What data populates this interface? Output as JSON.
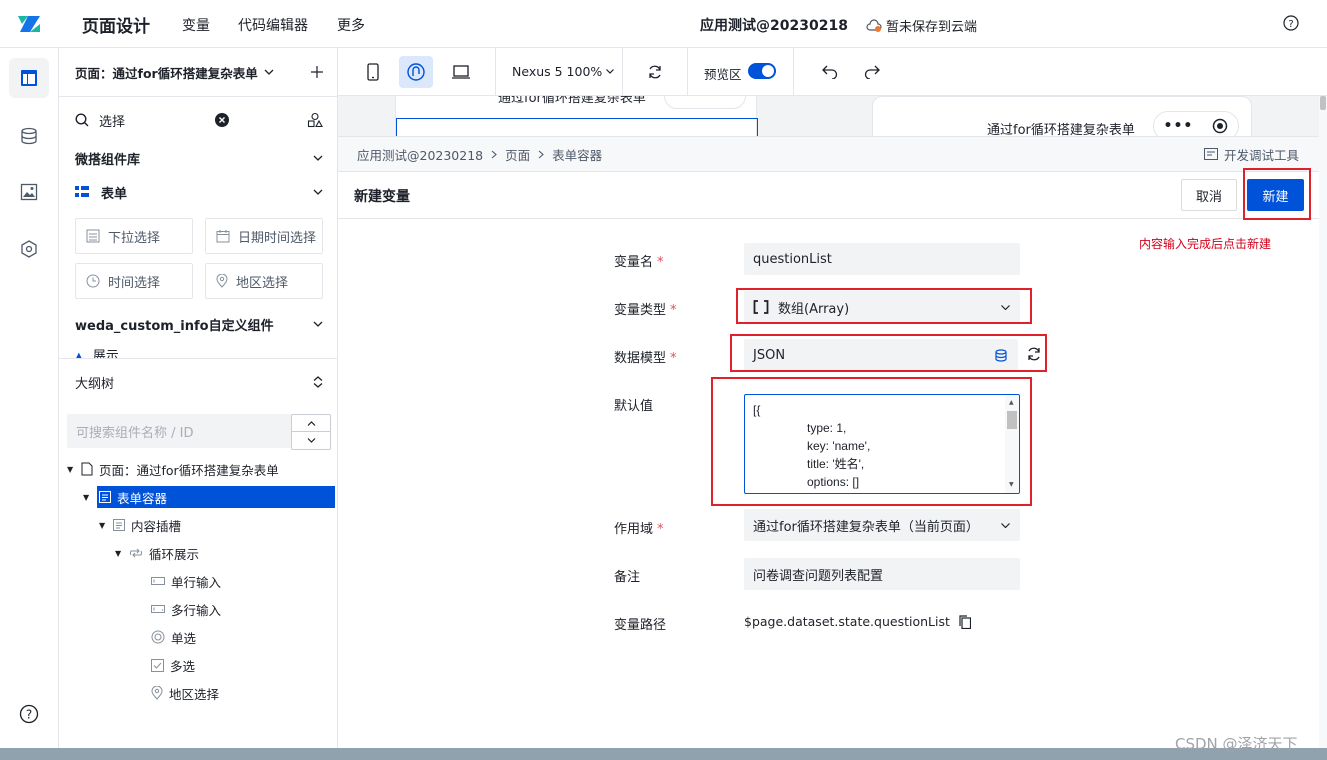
{
  "topbar": {
    "title": "页面设计",
    "nav": [
      "变量",
      "代码编辑器",
      "更多"
    ],
    "app_name": "应用测试@20230218",
    "save_status": "暂未保存到云端"
  },
  "left_panel": {
    "page_selector": "页面：通过for循环搭建复杂表单",
    "search_value": "选择",
    "library_title": "微搭组件库",
    "category": "表单",
    "components": [
      "下拉选择",
      "日期时间选择",
      "时间选择",
      "地区选择"
    ],
    "custom_group": "weda_custom_info自定义组件",
    "custom_partial": "展示",
    "outline_title": "大纲树",
    "outline_search_placeholder": "可搜索组件名称 / ID",
    "tree": {
      "page": "页面：通过for循环搭建复杂表单",
      "form_container": "表单容器",
      "content_slot": "内容插槽",
      "loop": "循环展示",
      "items": [
        "单行输入",
        "多行输入",
        "单选",
        "多选",
        "地区选择"
      ]
    }
  },
  "toolbar": {
    "device": "Nexus 5 100%",
    "preview_label": "预览区"
  },
  "canvas": {
    "left_title": "通过for循环搭建复杂表单",
    "right_title": "通过for循环搭建复杂表单"
  },
  "dialog": {
    "breadcrumb": [
      "应用测试@20230218",
      "页面",
      "表单容器"
    ],
    "dev_tools": "开发调试工具",
    "title": "新建变量",
    "cancel": "取消",
    "create": "新建",
    "annotation": "内容输入完成后点击新建",
    "labels": {
      "name": "变量名",
      "type": "变量类型",
      "model": "数据模型",
      "default": "默认值",
      "scope": "作用域",
      "note": "备注",
      "path": "变量路径"
    },
    "values": {
      "name": "questionList",
      "type": "数组(Array)",
      "model": "JSON",
      "default_lines": [
        "[{",
        "type: 1,",
        "key: 'name',",
        "title: '姓名',",
        "options: []"
      ],
      "scope": "通过for循环搭建复杂表单（当前页面）",
      "note": "问卷调查问题列表配置",
      "path": "$page.dataset.state.questionList"
    }
  },
  "watermark": "CSDN @泽济天下",
  "colors": {
    "primary": "#0052d9",
    "highlight": "#e0202a",
    "annotation": "#d0021b"
  }
}
